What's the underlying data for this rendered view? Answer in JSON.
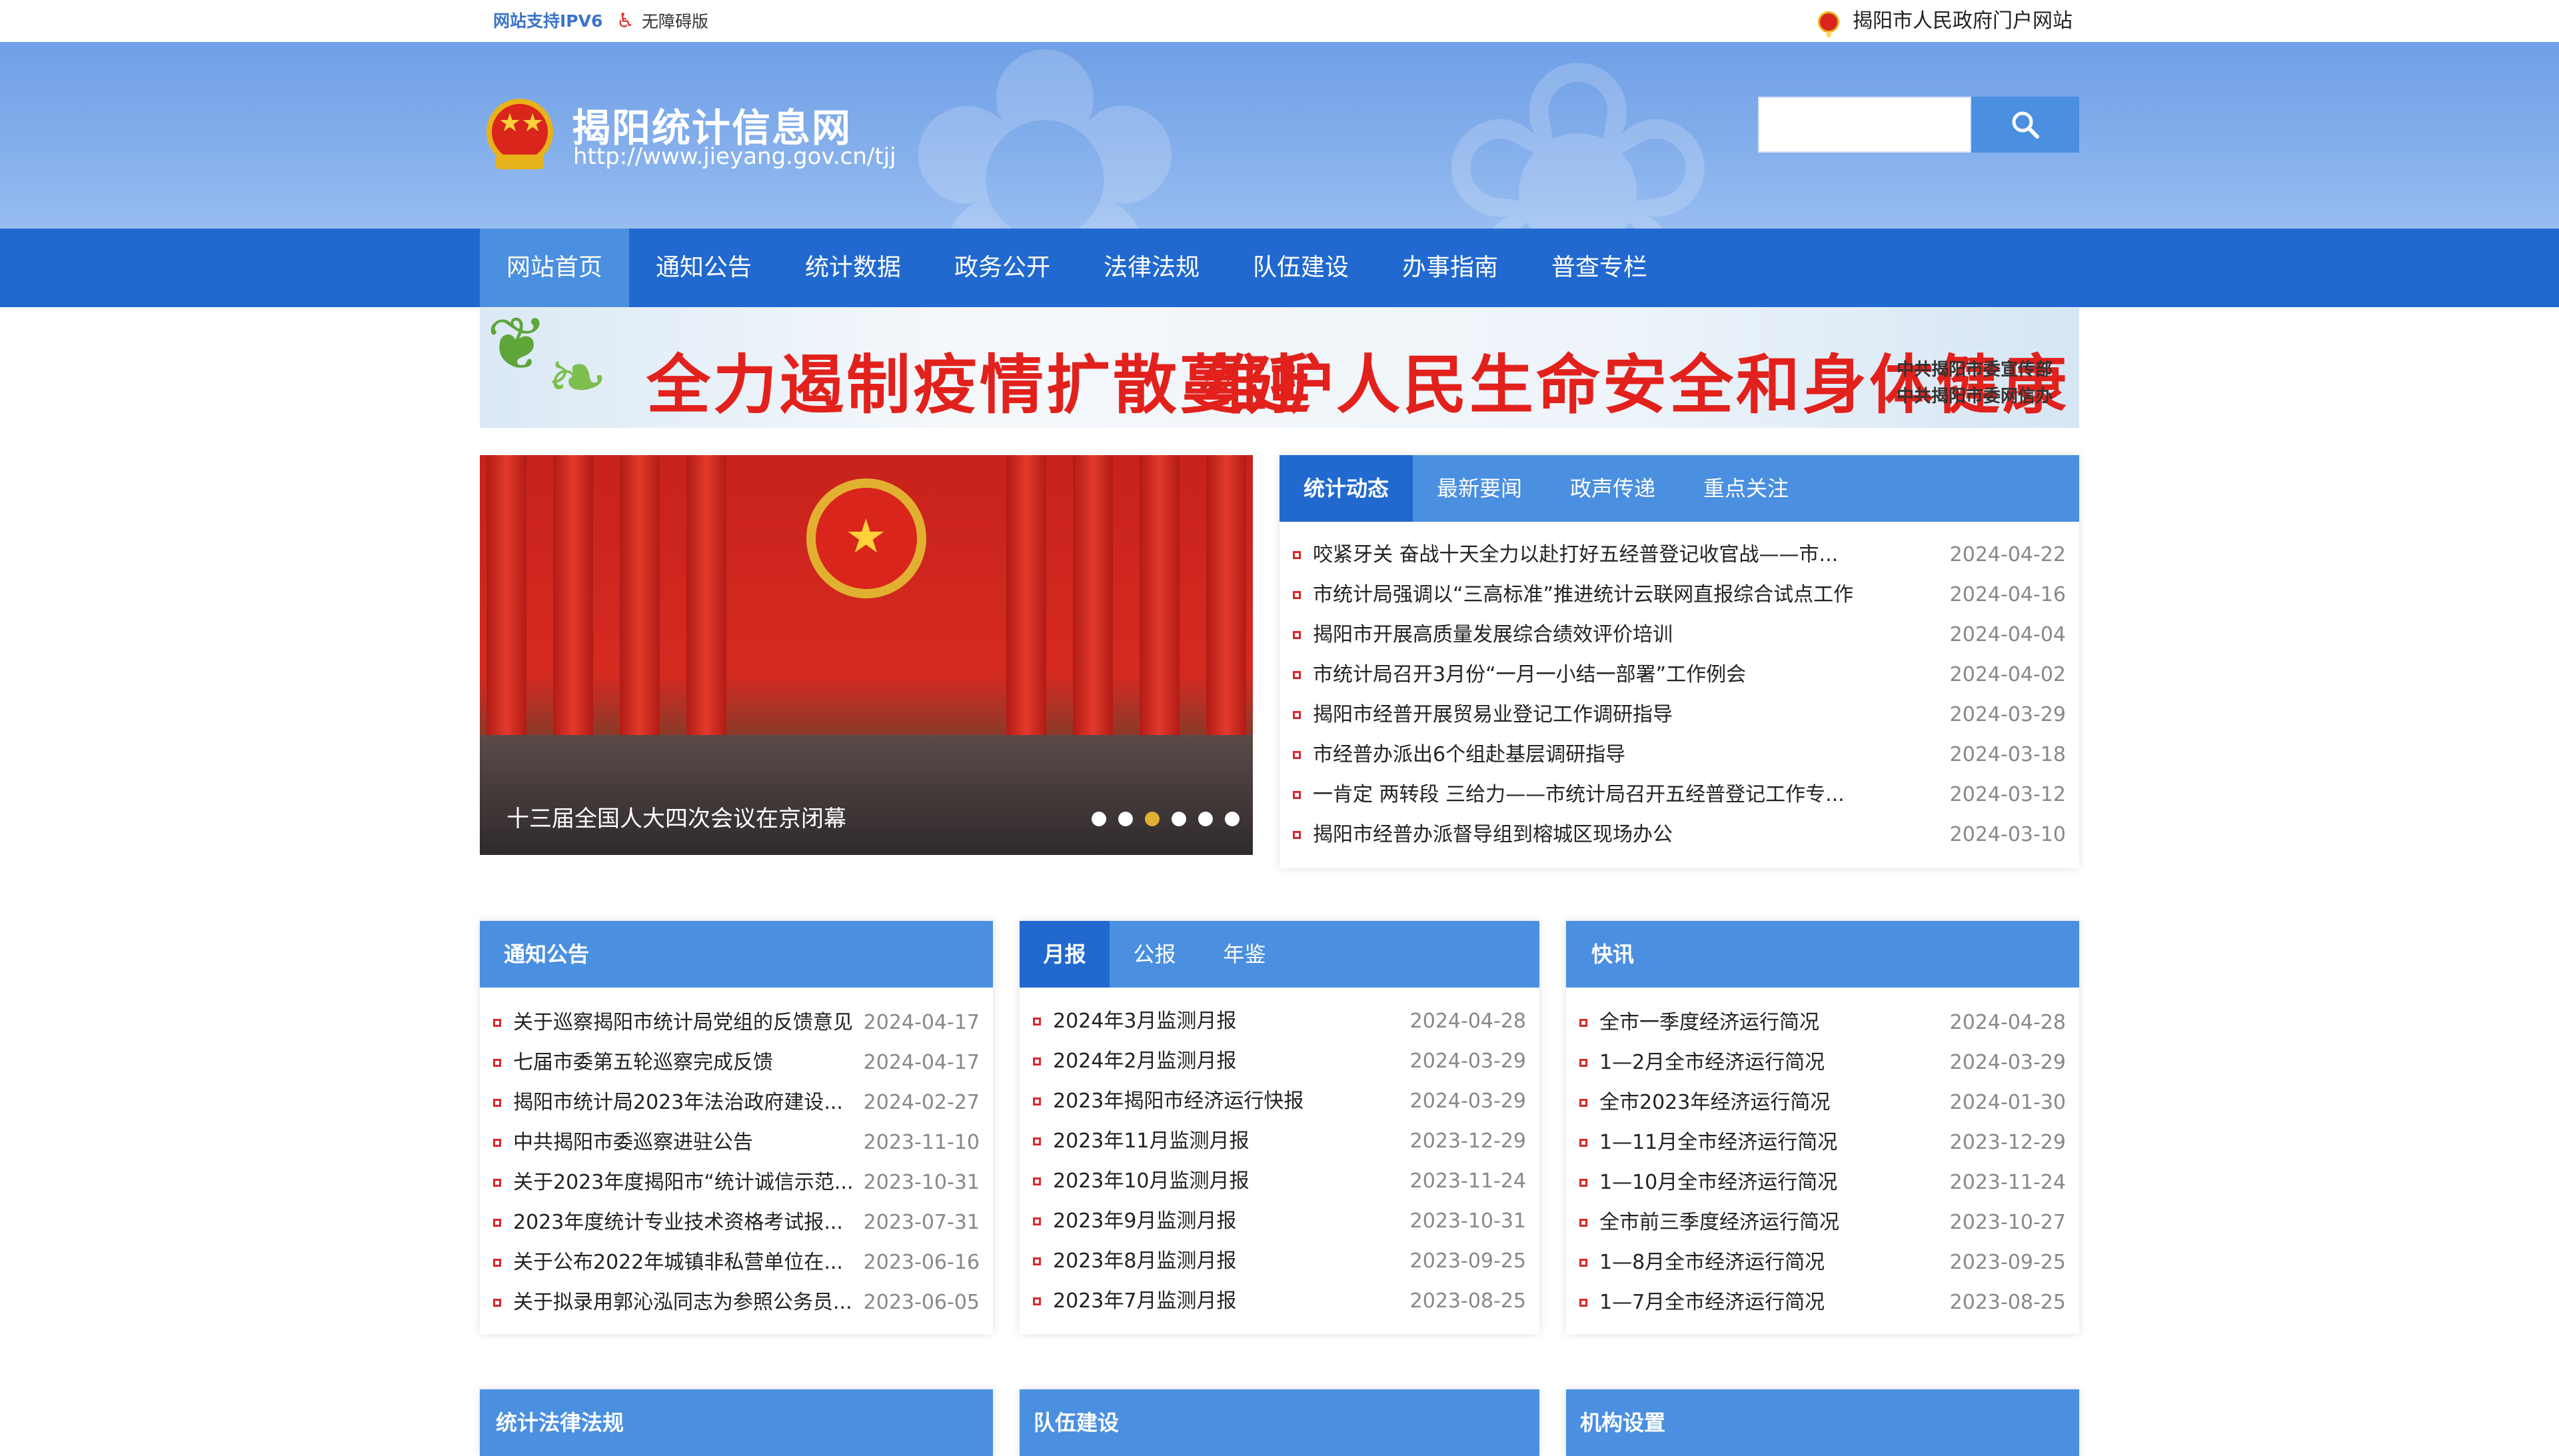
{
  "topbar": {
    "ipv6": "网站支持IPV6",
    "accessible": "无障碍版",
    "gov_portal": "揭阳市人民政府门户网站"
  },
  "header": {
    "title": "揭阳统计信息网",
    "url": "http://www.jieyang.gov.cn/tjj",
    "search_placeholder": ""
  },
  "nav": {
    "items": [
      "网站首页",
      "通知公告",
      "统计数据",
      "政务公开",
      "法律法规",
      "队伍建设",
      "办事指南",
      "普查专栏"
    ],
    "active_index": 0
  },
  "banner": {
    "slogan_left": "全力遏制疫情扩散蔓延",
    "slogan_right": "维护人民生命安全和身体健康",
    "org_1": "中共揭阳市委宣传部",
    "org_2": "中共揭阳市委网信办"
  },
  "slider": {
    "caption": "十三届全国人大四次会议在京闭幕",
    "dot_count": 6,
    "active_dot": 2
  },
  "news": {
    "tabs": [
      "统计动态",
      "最新要闻",
      "政声传递",
      "重点关注"
    ],
    "items": [
      {
        "title": "咬紧牙关 奋战十天全力以赴打好五经普登记收官战——市...",
        "date": "2024-04-22"
      },
      {
        "title": "市统计局强调以“三高标准”推进统计云联网直报综合试点工作",
        "date": "2024-04-16"
      },
      {
        "title": "揭阳市开展高质量发展综合绩效评价培训",
        "date": "2024-04-04"
      },
      {
        "title": "市统计局召开3月份“一月一小结一部署”工作例会",
        "date": "2024-04-02"
      },
      {
        "title": "揭阳市经普开展贸易业登记工作调研指导",
        "date": "2024-03-29"
      },
      {
        "title": "市经普办派出6个组赴基层调研指导",
        "date": "2024-03-18"
      },
      {
        "title": "一肯定 两转段 三给力——市统计局召开五经普登记工作专...",
        "date": "2024-03-12"
      },
      {
        "title": "揭阳市经普办派督导组到榕城区现场办公",
        "date": "2024-03-10"
      }
    ]
  },
  "notices": {
    "tabs": [
      "通知公告"
    ],
    "items": [
      {
        "title": "关于巡察揭阳市统计局党组的反馈意见",
        "date": "2024-04-17"
      },
      {
        "title": "七届市委第五轮巡察完成反馈",
        "date": "2024-04-17"
      },
      {
        "title": "揭阳市统计局2023年法治政府建设...",
        "date": "2024-02-27"
      },
      {
        "title": "中共揭阳市委巡察进驻公告",
        "date": "2023-11-10"
      },
      {
        "title": "关于2023年度揭阳市“统计诚信示范...",
        "date": "2023-10-31"
      },
      {
        "title": "2023年度统计专业技术资格考试报...",
        "date": "2023-07-31"
      },
      {
        "title": "关于公布2022年城镇非私营单位在...",
        "date": "2023-06-16"
      },
      {
        "title": "关于拟录用郭沁泓同志为参照公务员...",
        "date": "2023-06-05"
      }
    ]
  },
  "reports": {
    "tabs": [
      "月报",
      "公报",
      "年鉴"
    ],
    "items": [
      {
        "title": "2024年3月监测月报",
        "date": "2024-04-28"
      },
      {
        "title": "2024年2月监测月报",
        "date": "2024-03-29"
      },
      {
        "title": "2023年揭阳市经济运行快报",
        "date": "2024-03-29"
      },
      {
        "title": "2023年11月监测月报",
        "date": "2023-12-29"
      },
      {
        "title": "2023年10月监测月报",
        "date": "2023-11-24"
      },
      {
        "title": "2023年9月监测月报",
        "date": "2023-10-31"
      },
      {
        "title": "2023年8月监测月报",
        "date": "2023-09-25"
      },
      {
        "title": "2023年7月监测月报",
        "date": "2023-08-25"
      }
    ]
  },
  "flash": {
    "tabs": [
      "快讯"
    ],
    "items": [
      {
        "title": "全市一季度经济运行简况",
        "date": "2024-04-28"
      },
      {
        "title": "1—2月全市经济运行简况",
        "date": "2024-03-29"
      },
      {
        "title": "全市2023年经济运行简况",
        "date": "2024-01-30"
      },
      {
        "title": "1—11月全市经济运行简况",
        "date": "2023-12-29"
      },
      {
        "title": "1—10月全市经济运行简况",
        "date": "2023-11-24"
      },
      {
        "title": "全市前三季度经济运行简况",
        "date": "2023-10-27"
      },
      {
        "title": "1—8月全市经济运行简况",
        "date": "2023-09-25"
      },
      {
        "title": "1—7月全市经济运行简况",
        "date": "2023-08-25"
      }
    ]
  },
  "bottom_panels": {
    "laws": "统计法律法规",
    "team": "队伍建设",
    "org": "机构设置"
  },
  "colors": {
    "nav_bg": "#2169cf",
    "tab_bg": "#4a8fe0",
    "header_bg": "#7fa9ea",
    "bullet": "#d8282a",
    "slogan": "#e2211c"
  }
}
